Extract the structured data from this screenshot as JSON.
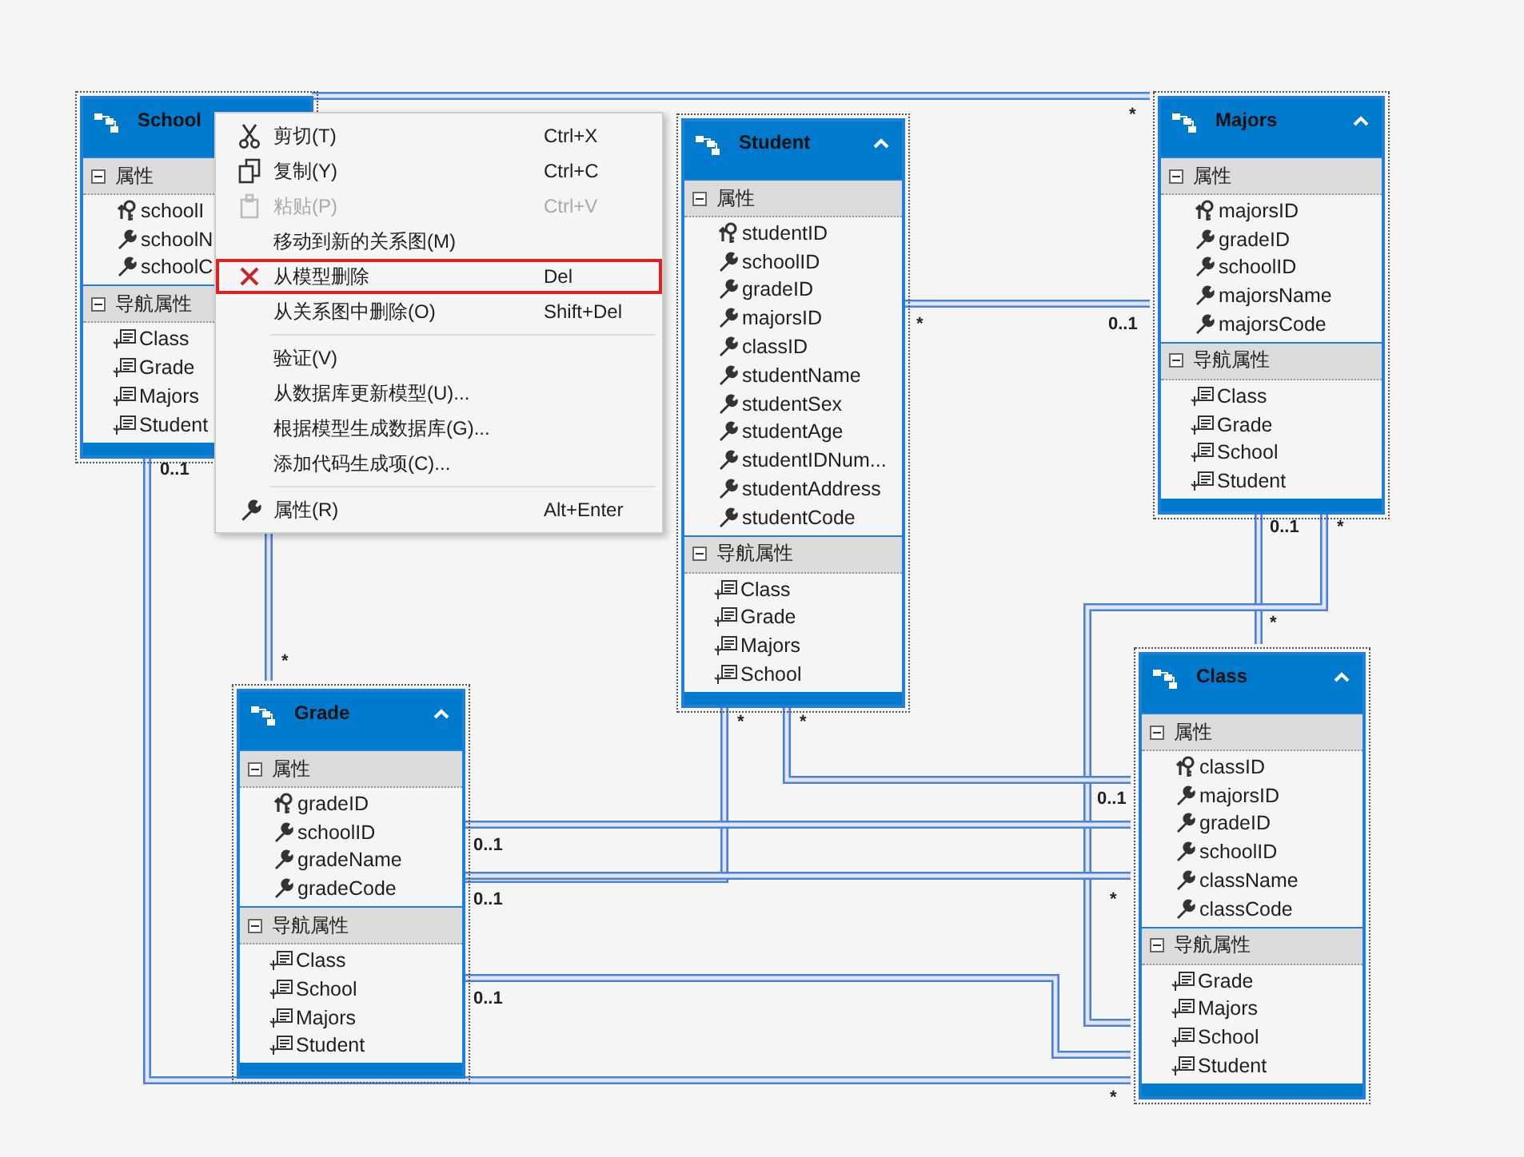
{
  "entities": [
    {
      "name": "School",
      "properties_label": "属性",
      "navigation_label": "导航属性",
      "properties": [
        {
          "name": "schoolI",
          "kind": "key"
        },
        {
          "name": "schoolN",
          "kind": "scalar"
        },
        {
          "name": "schoolC",
          "kind": "scalar"
        }
      ],
      "navigation": [
        "Class",
        "Grade",
        "Majors",
        "Student"
      ]
    },
    {
      "name": "Student",
      "properties_label": "属性",
      "navigation_label": "导航属性",
      "properties": [
        {
          "name": "studentID",
          "kind": "key"
        },
        {
          "name": "schoolID",
          "kind": "scalar"
        },
        {
          "name": "gradeID",
          "kind": "scalar"
        },
        {
          "name": "majorsID",
          "kind": "scalar"
        },
        {
          "name": "classID",
          "kind": "scalar"
        },
        {
          "name": "studentName",
          "kind": "scalar"
        },
        {
          "name": "studentSex",
          "kind": "scalar"
        },
        {
          "name": "studentAge",
          "kind": "scalar"
        },
        {
          "name": "studentIDNum...",
          "kind": "scalar"
        },
        {
          "name": "studentAddress",
          "kind": "scalar"
        },
        {
          "name": "studentCode",
          "kind": "scalar"
        }
      ],
      "navigation": [
        "Class",
        "Grade",
        "Majors",
        "School"
      ]
    },
    {
      "name": "Majors",
      "properties_label": "属性",
      "navigation_label": "导航属性",
      "properties": [
        {
          "name": "majorsID",
          "kind": "key"
        },
        {
          "name": "gradeID",
          "kind": "scalar"
        },
        {
          "name": "schoolID",
          "kind": "scalar"
        },
        {
          "name": "majorsName",
          "kind": "scalar"
        },
        {
          "name": "majorsCode",
          "kind": "scalar"
        }
      ],
      "navigation": [
        "Class",
        "Grade",
        "School",
        "Student"
      ]
    },
    {
      "name": "Grade",
      "properties_label": "属性",
      "navigation_label": "导航属性",
      "properties": [
        {
          "name": "gradeID",
          "kind": "key"
        },
        {
          "name": "schoolID",
          "kind": "scalar"
        },
        {
          "name": "gradeName",
          "kind": "scalar"
        },
        {
          "name": "gradeCode",
          "kind": "scalar"
        }
      ],
      "navigation": [
        "Class",
        "School",
        "Majors",
        "Student"
      ]
    },
    {
      "name": "Class",
      "properties_label": "属性",
      "navigation_label": "导航属性",
      "properties": [
        {
          "name": "classID",
          "kind": "key"
        },
        {
          "name": "majorsID",
          "kind": "scalar"
        },
        {
          "name": "gradeID",
          "kind": "scalar"
        },
        {
          "name": "schoolID",
          "kind": "scalar"
        },
        {
          "name": "className",
          "kind": "scalar"
        },
        {
          "name": "classCode",
          "kind": "scalar"
        }
      ],
      "navigation": [
        "Grade",
        "Majors",
        "School",
        "Student"
      ]
    }
  ],
  "multiplicities": [
    "*",
    "0..1",
    "*",
    "0..1",
    "0..1",
    "*",
    "*",
    "*",
    "*",
    "*",
    "0..1",
    "0..1",
    "0..1",
    "0..1",
    "*",
    "*"
  ],
  "context_menu": [
    {
      "kind": "cut",
      "label": "剪切(T)",
      "shortcut": "Ctrl+X",
      "disabled": false,
      "highlighted": false
    },
    {
      "kind": "copy",
      "label": "复制(Y)",
      "shortcut": "Ctrl+C",
      "disabled": false,
      "highlighted": false
    },
    {
      "kind": "paste",
      "label": "粘贴(P)",
      "shortcut": "Ctrl+V",
      "disabled": true,
      "highlighted": false
    },
    {
      "kind": "item",
      "label": "移动到新的关系图(M)",
      "disabled": false,
      "highlighted": false
    },
    {
      "kind": "delete",
      "label": "从模型删除",
      "shortcut": "Del",
      "disabled": false,
      "highlighted": true
    },
    {
      "kind": "item",
      "label": "从关系图中删除(O)",
      "shortcut": "Shift+Del",
      "disabled": false,
      "highlighted": false
    },
    {
      "kind": "separator"
    },
    {
      "kind": "item",
      "label": "验证(V)",
      "disabled": false,
      "highlighted": false
    },
    {
      "kind": "item",
      "label": "从数据库更新模型(U)...",
      "disabled": false,
      "highlighted": false
    },
    {
      "kind": "item",
      "label": "根据模型生成数据库(G)...",
      "disabled": false,
      "highlighted": false
    },
    {
      "kind": "item",
      "label": "添加代码生成项(C)...",
      "disabled": false,
      "highlighted": false
    },
    {
      "kind": "separator"
    },
    {
      "kind": "properties",
      "label": "属性(R)",
      "shortcut": "Alt+Enter",
      "disabled": false,
      "highlighted": false
    }
  ]
}
